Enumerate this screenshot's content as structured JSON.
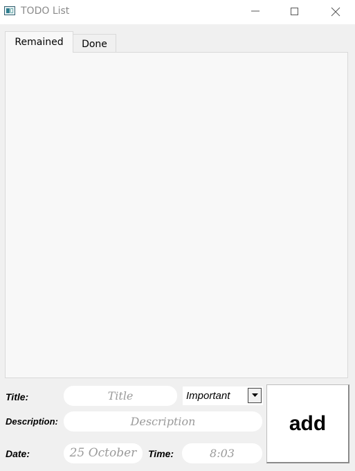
{
  "window": {
    "title": "TODO List",
    "icon": "app-window-icon",
    "controls": [
      "minimize-icon",
      "maximize-icon",
      "close-icon"
    ]
  },
  "tabs": [
    {
      "label": "Remained",
      "active": true
    },
    {
      "label": "Done",
      "active": false
    }
  ],
  "form": {
    "title_label": "Title:",
    "title_placeholder": "Title",
    "priority_value": "Important",
    "description_label": "Description:",
    "description_placeholder": "Description",
    "date_label": "Date:",
    "date_value": "25 October",
    "time_label": "Time:",
    "time_value": "8:03",
    "add_label": "add"
  }
}
